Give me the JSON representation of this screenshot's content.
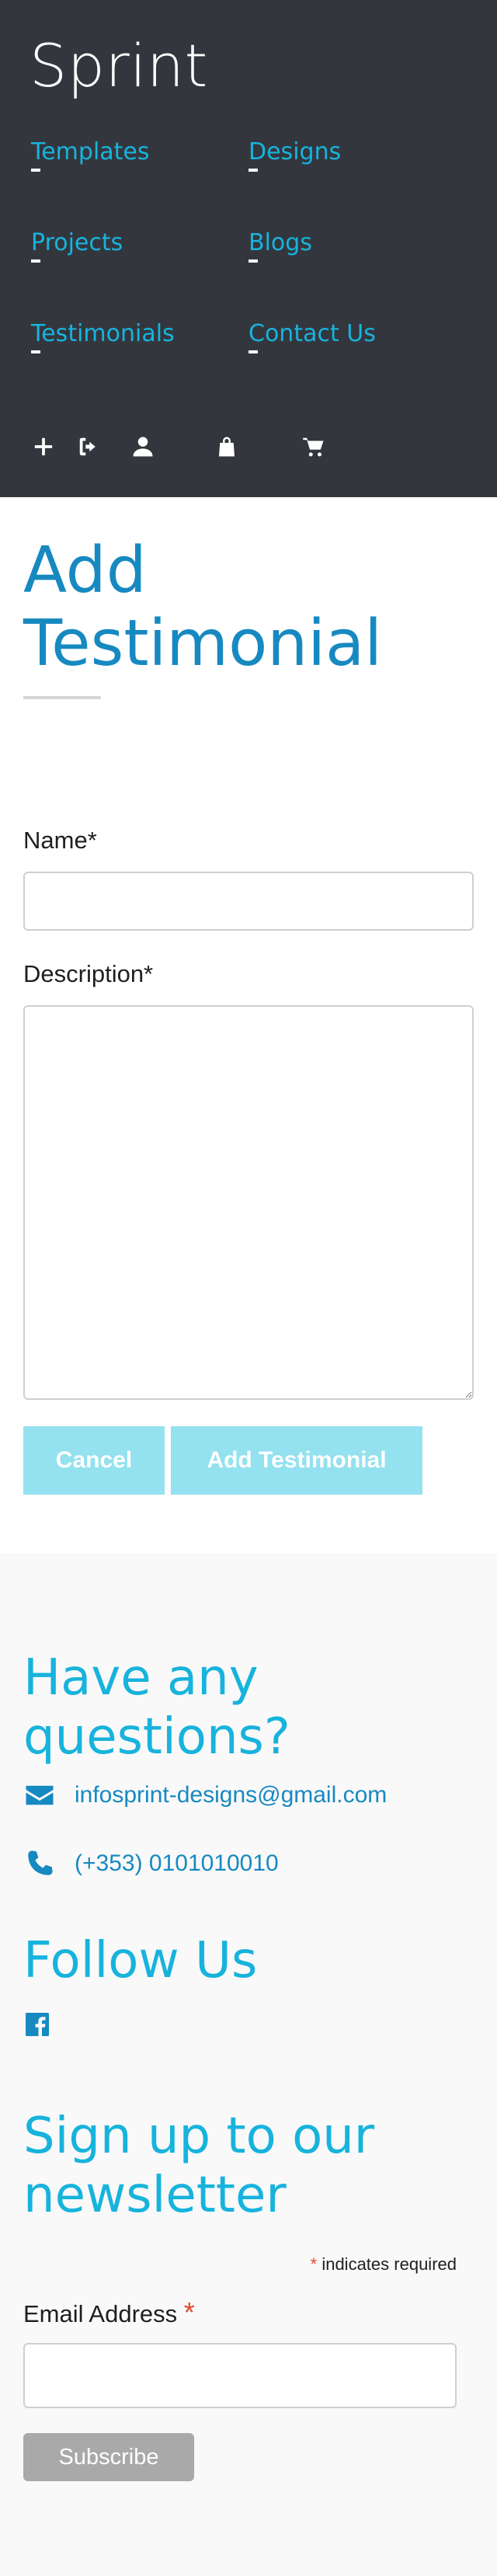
{
  "header": {
    "brand": "Sprint",
    "nav": [
      {
        "label": "Templates"
      },
      {
        "label": "Designs"
      },
      {
        "label": "Projects"
      },
      {
        "label": "Blogs"
      },
      {
        "label": "Testimonials"
      },
      {
        "label": "Contact Us"
      }
    ],
    "icons": [
      "plus-icon",
      "sign-out-icon",
      "user-icon",
      "shopping-bag-icon",
      "cart-icon"
    ]
  },
  "main": {
    "title_line1": "Add",
    "title_line2": "Testimonial",
    "name_label": "Name*",
    "name_value": "",
    "description_label": "Description*",
    "description_value": "",
    "cancel_label": "Cancel",
    "submit_label": "Add Testimonial"
  },
  "footer": {
    "questions_heading": "Have any questions?",
    "email": "infosprint-designs@gmail.com",
    "phone": "(+353) 0101010010",
    "follow_heading": "Follow Us",
    "newsletter_heading": "Sign up to our newsletter",
    "required_asterisk": "*",
    "required_note": "indicates required",
    "email_address_label": "Email Address",
    "email_address_value": "",
    "subscribe_label": "Subscribe"
  },
  "colors": {
    "header_bg": "#33373d",
    "accent": "#17b3dd",
    "title_blue": "#1789c1",
    "button_bg": "#94e1ef",
    "subscribe_bg": "#a9a9a9",
    "required_red": "#e04a2b"
  }
}
